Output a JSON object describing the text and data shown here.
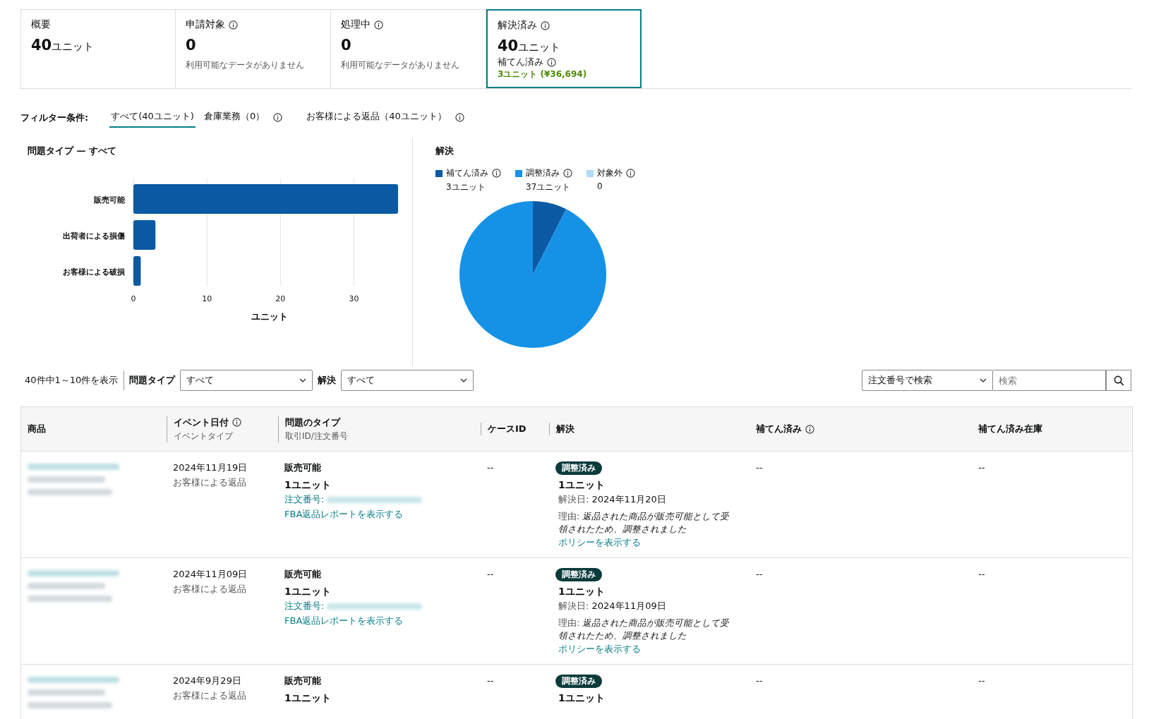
{
  "summary_cards": [
    {
      "title": "概要",
      "value": "40",
      "unit": "ユニット",
      "selected": false
    },
    {
      "title": "申請対象",
      "info": true,
      "value": "0",
      "note": "利用可能なデータがありません",
      "selected": false
    },
    {
      "title": "処理中",
      "info": true,
      "value": "0",
      "note": "利用可能なデータがありません",
      "selected": false
    },
    {
      "title": "解決済み",
      "info": true,
      "value": "40",
      "unit": "ユニット",
      "sub_label": "補てん済み",
      "sub_value": "3ユニット (¥36,694)",
      "selected": true
    }
  ],
  "filter": {
    "label": "フィルター条件:",
    "tabs": [
      {
        "label": "すべて(40ユニット)",
        "selected": true
      },
      {
        "label": "倉庫業務（0）",
        "info": true,
        "selected": false
      },
      {
        "label": "お客様による返品（40ユニット）",
        "info": true,
        "selected": false
      }
    ]
  },
  "issue_chart": {
    "title": "問題タイプ — すべて",
    "chart_data": {
      "type": "bar",
      "orientation": "horizontal",
      "xlabel": "ユニット",
      "categories": [
        "販売可能",
        "出荷者による損傷",
        "お客様による破損"
      ],
      "values": [
        36,
        3,
        1
      ],
      "xlim": [
        0,
        36
      ],
      "xticks": [
        0,
        10,
        20,
        30
      ],
      "grid": true
    }
  },
  "resolution_chart": {
    "title": "解決",
    "legend": [
      {
        "value": "3ユニット",
        "color": "#0b5aa3"
      },
      {
        "value": "37ユニット",
        "color": "#1592e6"
      },
      {
        "value": "0",
        "color": "#b3daf7"
      }
    ],
    "chart_data": {
      "type": "pie",
      "categories": [
        "補てん済み",
        "調整済み",
        "対象外"
      ],
      "values": [
        7.5,
        92.5,
        0
      ]
    }
  },
  "toolbar": {
    "count": "40件中1～10件を表示",
    "issue_type_label": "問題タイプ",
    "issue_type_value": "すべて",
    "resolution_label": "解決",
    "resolution_value": "すべて",
    "search_by": "注文番号で検索",
    "search_placeholder": "検索"
  },
  "table": {
    "columns": [
      {
        "title": "商品"
      },
      {
        "title": "イベント日付",
        "subtitle": "イベントタイプ",
        "info": true
      },
      {
        "title": "問題のタイプ",
        "subtitle": "取引ID/注文番号"
      },
      {
        "title": "ケースID"
      },
      {
        "title": "解決"
      },
      {
        "title": "補てん済み",
        "info": true
      },
      {
        "title": "補てん済み在庫"
      }
    ],
    "rows": [
      {
        "date": "2024年11月19日",
        "event_type": "お客様による返品",
        "issue": "販売可能",
        "units": "1ユニット",
        "order_label": "注文番号:",
        "report_link": "FBA返品レポートを表示する",
        "case_id": "--",
        "badge": "調整済み",
        "resolved_units": "1ユニット",
        "resolved_label": "解決日:",
        "resolved_date": "2024年11月20日",
        "reason_label": "理由:",
        "reason": "返品された商品が販売可能として受領されたため、調整されました",
        "policy_link": "ポリシーを表示する",
        "reimbursed": "--",
        "reimbursed_inventory": "--"
      },
      {
        "date": "2024年11月09日",
        "event_type": "お客様による返品",
        "issue": "販売可能",
        "units": "1ユニット",
        "order_label": "注文番号:",
        "report_link": "FBA返品レポートを表示する",
        "case_id": "--",
        "badge": "調整済み",
        "resolved_units": "1ユニット",
        "resolved_label": "解決日:",
        "resolved_date": "2024年11月09日",
        "reason_label": "理由:",
        "reason": "返品された商品が販売可能として受領されたため、調整されました",
        "policy_link": "ポリシーを表示する",
        "reimbursed": "--",
        "reimbursed_inventory": "--"
      },
      {
        "date": "2024年9月29日",
        "event_type": "お客様による返品",
        "issue": "販売可能",
        "units": "1ユニット",
        "case_id": "--",
        "badge": "調整済み",
        "resolved_units": "1ユニット",
        "reimbursed": "--",
        "reimbursed_inventory": "--"
      }
    ]
  }
}
